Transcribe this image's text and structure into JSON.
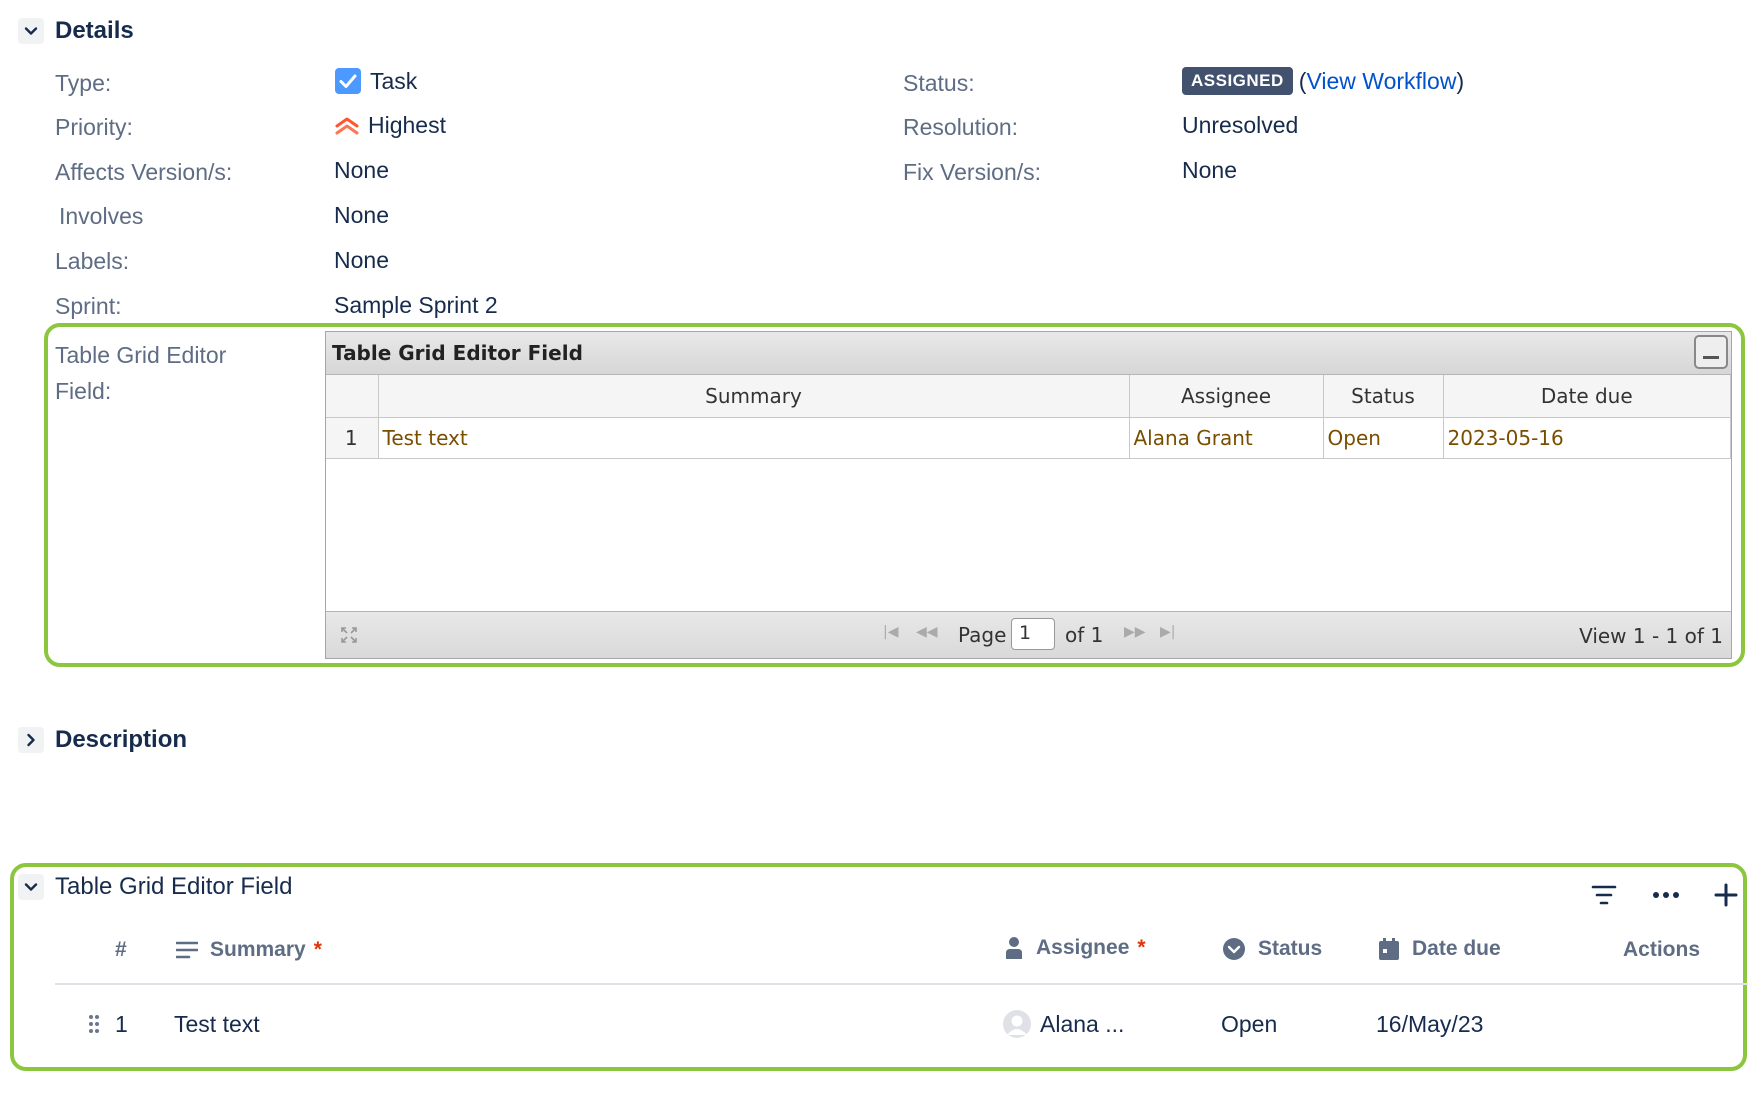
{
  "details": {
    "title": "Details",
    "left_fields": [
      {
        "label": "Type:",
        "value": "Task",
        "icon": "task-checkbox-icon"
      },
      {
        "label": "Priority:",
        "value": "Highest",
        "icon": "priority-highest-icon"
      },
      {
        "label": "Affects Version/s:",
        "value": "None"
      },
      {
        "label": "Involves",
        "value": "None"
      },
      {
        "label": "Labels:",
        "value": "None"
      },
      {
        "label": "Sprint:",
        "value": "Sample Sprint 2"
      }
    ],
    "right_fields": [
      {
        "label": "Status:",
        "badge": "ASSIGNED",
        "link_open": "(",
        "link": "View Workflow",
        "link_close": ")"
      },
      {
        "label": "Resolution:",
        "value": "Unresolved"
      },
      {
        "label": "Fix Version/s:",
        "value": "None"
      }
    ],
    "tge_label_line1": "Table Grid Editor",
    "tge_label_line2": "Field:"
  },
  "legacy_grid": {
    "caption": "Table Grid Editor Field",
    "columns": [
      "",
      "Summary",
      "Assignee",
      "Status",
      "Date due"
    ],
    "rows": [
      {
        "num": "1",
        "summary": "Test text",
        "assignee": "Alana Grant",
        "status": "Open",
        "date_due": "2023-05-16"
      }
    ],
    "pager": {
      "page_label": "Page",
      "page_value": "1",
      "of_label": "of 1",
      "view_label": "View 1 - 1 of 1"
    }
  },
  "description": {
    "title": "Description"
  },
  "tge_section": {
    "title": "Table Grid Editor Field",
    "columns": {
      "num": "#",
      "summary": "Summary",
      "assignee": "Assignee",
      "status": "Status",
      "date_due": "Date due",
      "actions": "Actions"
    },
    "required_mark": "*",
    "rows": [
      {
        "num": "1",
        "summary": "Test text",
        "assignee": "Alana ...",
        "status": "Open",
        "date_due": "16/May/23"
      }
    ]
  },
  "colors": {
    "highlight": "#8cc63f",
    "badge": "#42526e",
    "link": "#0052cc",
    "grid_text": "#7a4e00"
  }
}
